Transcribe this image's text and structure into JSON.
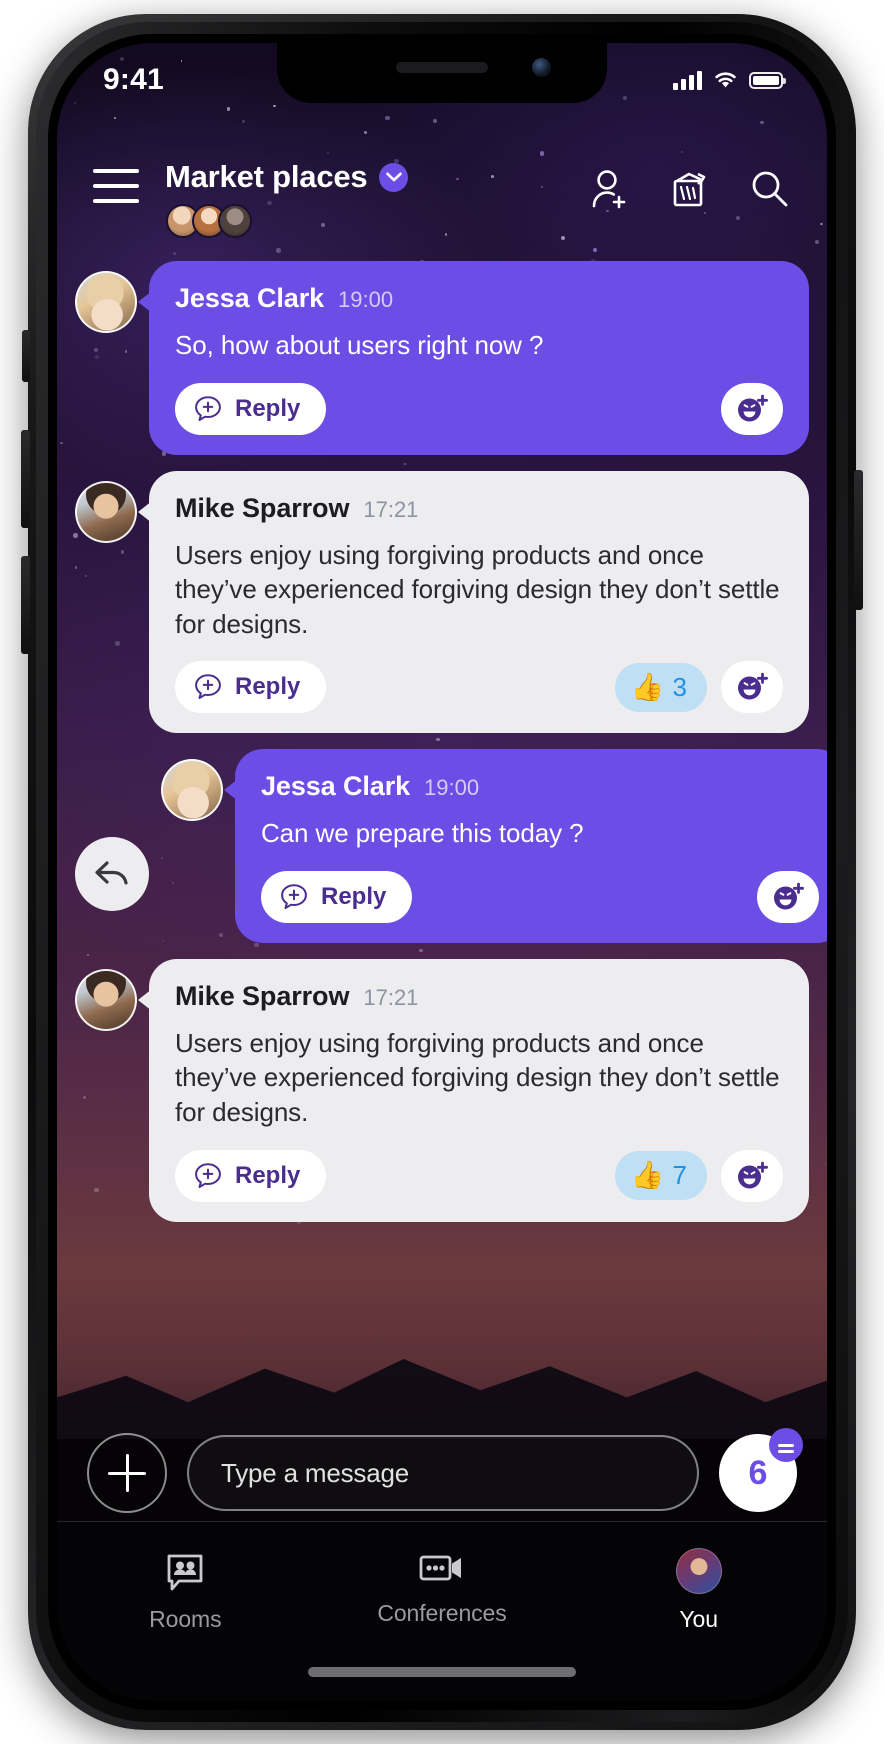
{
  "status_bar": {
    "time": "9:41",
    "signal_icon": "cellular-signal-icon",
    "wifi_icon": "wifi-icon",
    "battery_icon": "battery-full-icon"
  },
  "header": {
    "menu_icon": "hamburger-menu-icon",
    "title": "Market places",
    "chevron_icon": "chevron-down-icon",
    "members": [
      "member-avatar-1",
      "member-avatar-2",
      "member-avatar-3"
    ],
    "actions": [
      {
        "name": "add-person-icon",
        "label": "Add person"
      },
      {
        "name": "whiteboard-icon",
        "label": "Whiteboard"
      },
      {
        "name": "search-icon",
        "label": "Search"
      }
    ]
  },
  "messages": [
    {
      "id": "msg-1",
      "author": "Jessa Clark",
      "time": "19:00",
      "text": "So, how about users right now ?",
      "side": "them",
      "avatar": "jessa-avatar",
      "reply_label": "Reply",
      "reply_icon": "reply-bubble-plus-icon",
      "emoji_add_icon": "add-reaction-icon",
      "reactions": []
    },
    {
      "id": "msg-2",
      "author": "Mike Sparrow",
      "time": "17:21",
      "text": "Users enjoy using forgiving products and once they’ve experienced forgiving design they don’t settle for designs.",
      "side": "me",
      "avatar": "mike-avatar",
      "reply_label": "Reply",
      "reply_icon": "reply-bubble-plus-icon",
      "emoji_add_icon": "add-reaction-icon",
      "reactions": [
        {
          "emoji": "👍",
          "emoji_name": "thumbs-up-emoji",
          "count": "3"
        }
      ]
    },
    {
      "id": "msg-3",
      "author": "Jessa Clark",
      "time": "19:00",
      "text": "Can we prepare this today ?",
      "side": "them",
      "avatar": "jessa-avatar",
      "reply_label": "Reply",
      "reply_icon": "reply-bubble-plus-icon",
      "emoji_add_icon": "add-reaction-icon",
      "swiped": true,
      "swipe_action_icon": "reply-arrow-icon",
      "reactions": []
    },
    {
      "id": "msg-4",
      "author": "Mike Sparrow",
      "time": "17:21",
      "text": "Users enjoy using forgiving products and once they’ve experienced forgiving design they don’t settle for designs.",
      "side": "me",
      "avatar": "mike-avatar",
      "reply_label": "Reply",
      "reply_icon": "reply-bubble-plus-icon",
      "emoji_add_icon": "add-reaction-icon",
      "reactions": [
        {
          "emoji": "👍",
          "emoji_name": "thumbs-up-emoji",
          "count": "7"
        }
      ]
    }
  ],
  "composer": {
    "attach_icon": "plus-icon",
    "placeholder": "Type a message",
    "value": "",
    "send_count": "6",
    "send_badge_icon": "unread-messages-badge-icon"
  },
  "tabbar": {
    "tabs": [
      {
        "label": "Rooms",
        "icon": "rooms-people-bubble-icon",
        "active": false
      },
      {
        "label": "Conferences",
        "icon": "video-camera-icon",
        "active": false
      },
      {
        "label": "You",
        "icon": "profile-avatar-icon",
        "active": true
      }
    ]
  },
  "colors": {
    "accent_purple": "#6C4DE6",
    "bubble_light": "#EDECEE",
    "reply_text": "#4A2D8F",
    "reaction_bg": "#BFDFF5",
    "reaction_count": "#1C93E8"
  }
}
